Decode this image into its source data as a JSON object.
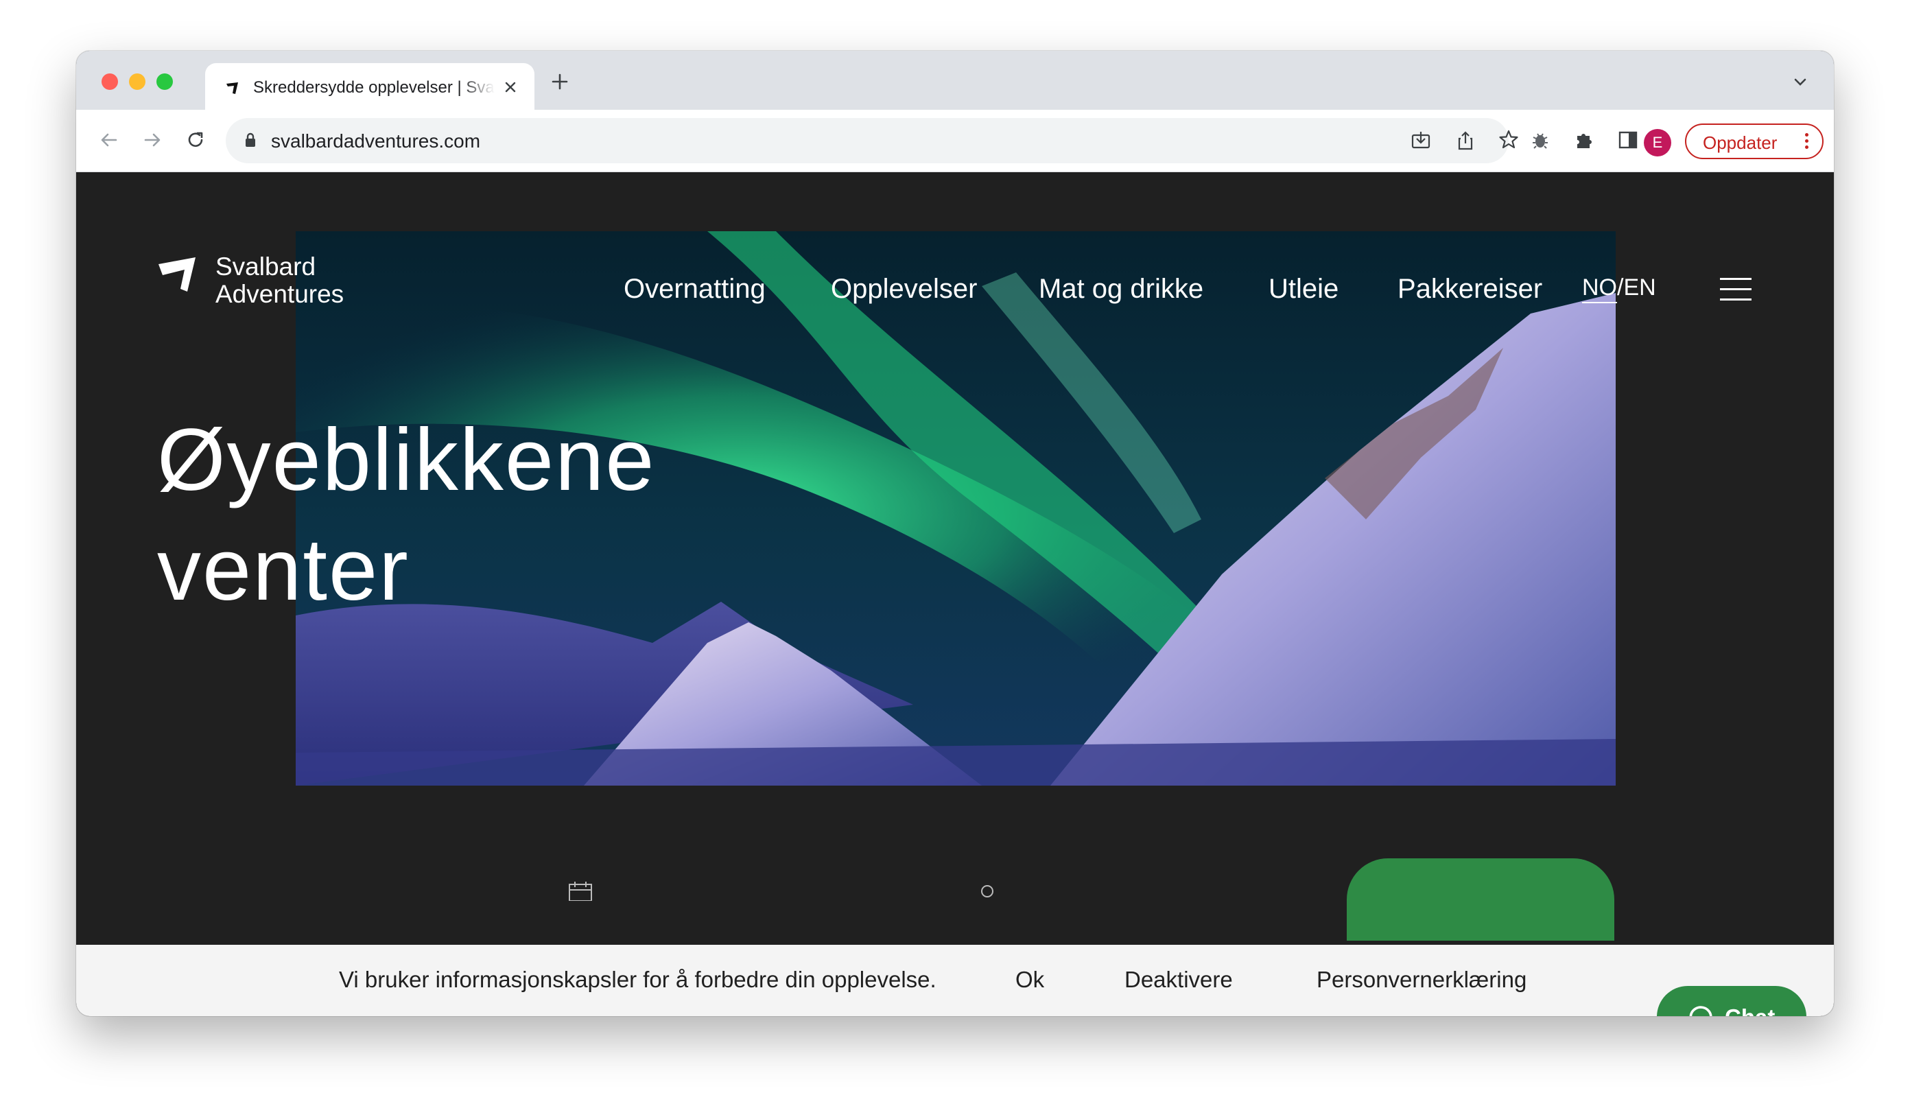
{
  "browser": {
    "tab_title": "Skreddersydde opplevelser | Svalbard Adventures",
    "url": "svalbardadventures.com",
    "profile_initial": "E",
    "update_label": "Oppdater",
    "icons": [
      "back-icon",
      "forward-icon",
      "reload-icon",
      "lock-icon",
      "install-icon",
      "share-icon",
      "bookmark-star-icon",
      "bug-icon",
      "extensions-icon",
      "side-panel-icon",
      "menu-dots-icon",
      "new-tab-icon",
      "tab-search-icon",
      "close-icon"
    ],
    "colors": {
      "tabbar": "#dee1e6",
      "update": "#c5221f",
      "avatar": "#c2185b"
    }
  },
  "site": {
    "logo_line1": "Svalbard",
    "logo_line2": "Adventures",
    "nav": [
      "Overnatting",
      "Opplevelser",
      "Mat og drikke",
      "Utleie",
      "Pakkereiser"
    ],
    "lang_no": "NO",
    "lang_sep": "/",
    "lang_en": "EN",
    "headline_line1": "Øyeblikkene",
    "headline_line2": "venter",
    "accent": "#2e8b45"
  },
  "cookie": {
    "message": "Vi bruker informasjonskapsler for å forbedre din opplevelse.",
    "ok": "Ok",
    "decline": "Deaktivere",
    "privacy": "Personvernerklæring"
  },
  "chat": {
    "label": "Chat"
  }
}
